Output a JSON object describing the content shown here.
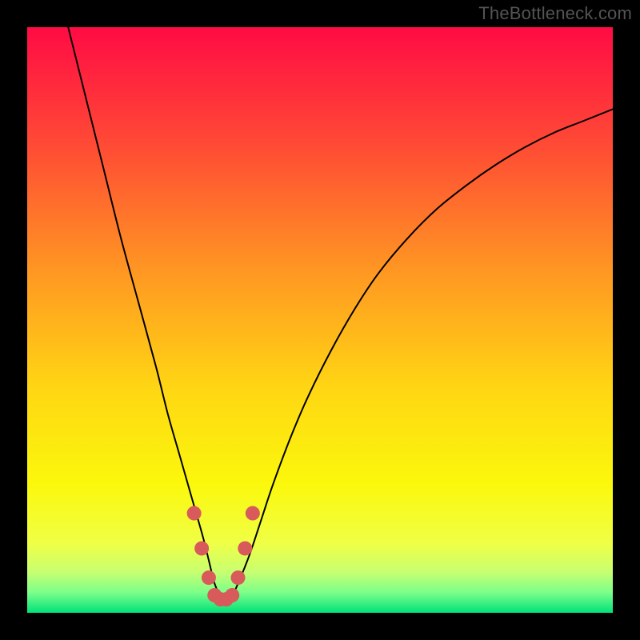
{
  "watermark": {
    "text": "TheBottleneck.com"
  },
  "chart_data": {
    "type": "line",
    "title": "",
    "xlabel": "",
    "ylabel": "",
    "xlim": [
      0,
      100
    ],
    "ylim": [
      0,
      100
    ],
    "grid": false,
    "series": [
      {
        "name": "curve",
        "stroke": "#000000",
        "stroke_width": 2,
        "x": [
          7,
          10,
          13,
          16,
          19,
          22,
          24,
          26,
          28,
          30,
          31,
          32,
          33,
          34,
          35,
          36,
          38,
          40,
          42,
          45,
          48,
          52,
          56,
          60,
          65,
          70,
          75,
          80,
          85,
          90,
          95,
          100
        ],
        "y": [
          100,
          88,
          76,
          64,
          53,
          42,
          34,
          27,
          20,
          13,
          9,
          5,
          3,
          2.5,
          3,
          5,
          10,
          16,
          22,
          30,
          37,
          45,
          52,
          58,
          64,
          69,
          73,
          76.5,
          79.5,
          82,
          84,
          86
        ]
      },
      {
        "name": "highlight-dots",
        "stroke": "#d85a5a",
        "marker": "circle",
        "marker_radius": 9,
        "x": [
          28.5,
          29.8,
          31.0,
          32.0,
          33.0,
          34.0,
          35.0,
          36.0,
          37.2,
          38.5
        ],
        "y": [
          17,
          11,
          6,
          3,
          2.3,
          2.3,
          3,
          6,
          11,
          17
        ]
      }
    ],
    "background_gradient": {
      "type": "vertical",
      "stops": [
        {
          "offset": 0.0,
          "color": "#ff0b44"
        },
        {
          "offset": 0.2,
          "color": "#ff4a35"
        },
        {
          "offset": 0.42,
          "color": "#ff9822"
        },
        {
          "offset": 0.62,
          "color": "#ffd713"
        },
        {
          "offset": 0.78,
          "color": "#fbf80c"
        },
        {
          "offset": 0.88,
          "color": "#f0ff45"
        },
        {
          "offset": 0.93,
          "color": "#c8ff70"
        },
        {
          "offset": 0.965,
          "color": "#7dff8a"
        },
        {
          "offset": 1.0,
          "color": "#00e27a"
        }
      ]
    }
  }
}
